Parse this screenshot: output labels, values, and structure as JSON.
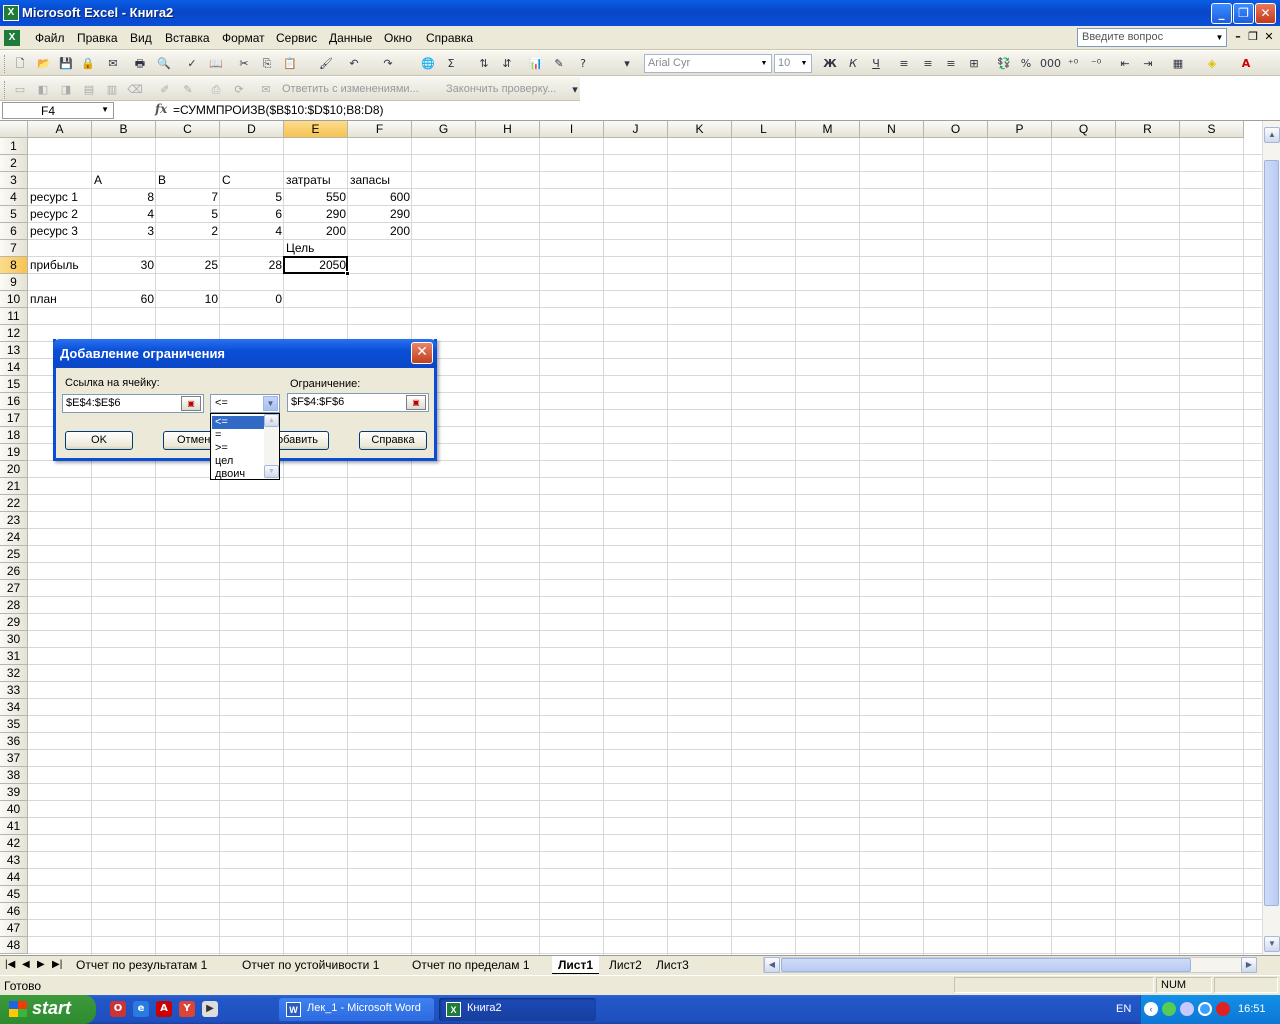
{
  "window": {
    "title": "Microsoft Excel - Книга2",
    "app_icon_letter": "X"
  },
  "menu": {
    "items": [
      "Файл",
      "Правка",
      "Вид",
      "Вставка",
      "Формат",
      "Сервис",
      "Данные",
      "Окно",
      "Справка"
    ],
    "ask_placeholder": "Введите вопрос"
  },
  "toolbar": {
    "font_name": "Arial Cyr",
    "font_size": "10",
    "reviewing_reply": "Ответить с изменениями...",
    "reviewing_end": "Закончить проверку..."
  },
  "formula_bar": {
    "name_box": "F4",
    "fx": "fx",
    "formula": "=СУММПРОИЗВ($B$10:$D$10;B8:D8)"
  },
  "columns": [
    "A",
    "B",
    "C",
    "D",
    "E",
    "F",
    "G",
    "H",
    "I",
    "J",
    "K",
    "L",
    "M",
    "N",
    "O",
    "P",
    "Q",
    "R",
    "S"
  ],
  "selected_column": "E",
  "selected_row": "8",
  "rows": [
    "1",
    "2",
    "3",
    "4",
    "5",
    "6",
    "7",
    "8",
    "9",
    "10",
    "11",
    "12",
    "13",
    "14",
    "15",
    "16",
    "17",
    "18",
    "19",
    "20",
    "21",
    "22",
    "23",
    "24",
    "25",
    "26",
    "27",
    "28",
    "29",
    "30",
    "31",
    "32",
    "33",
    "34",
    "35",
    "36",
    "37",
    "38",
    "39",
    "40",
    "41",
    "42",
    "43",
    "44",
    "45",
    "46",
    "47",
    "48"
  ],
  "cells": {
    "B3": "A",
    "C3": "B",
    "D3": "C",
    "E3": "затраты",
    "F3": "запасы",
    "A4": "ресурс 1",
    "B4": "8",
    "C4": "7",
    "D4": "5",
    "E4": "550",
    "F4": "600",
    "A5": "ресурс 2",
    "B5": "4",
    "C5": "5",
    "D5": "6",
    "E5": "290",
    "F5": "290",
    "A6": "ресурс 3",
    "B6": "3",
    "C6": "2",
    "D6": "4",
    "E6": "200",
    "F6": "200",
    "E7": "Цель",
    "A8": "прибыль",
    "B8": "30",
    "C8": "25",
    "D8": "28",
    "E8": "2050",
    "A10": "план",
    "B10": "60",
    "C10": "10",
    "D10": "0"
  },
  "sheet_tabs": [
    {
      "label": "Отчет по результатам 1",
      "active": false
    },
    {
      "label": "Отчет по устойчивости 1",
      "active": false
    },
    {
      "label": "Отчет по пределам 1",
      "active": false
    },
    {
      "label": "Лист1",
      "active": true
    },
    {
      "label": "Лист2",
      "active": false
    },
    {
      "label": "Лист3",
      "active": false
    }
  ],
  "status": {
    "text": "Готово",
    "num": "NUM"
  },
  "dialog": {
    "title": "Добавление ограничения",
    "cell_ref_label": "Ссылка на ячейку:",
    "cell_ref_value": "$E$4:$E$6",
    "operator_value": "<=",
    "constraint_label": "Ограничение:",
    "constraint_value": "$F$4:$F$6",
    "operator_options": [
      "<=",
      "=",
      ">=",
      "цел",
      "двоич"
    ],
    "ok": "OK",
    "cancel": "Отмена",
    "add": "Добавить",
    "help": "Справка"
  },
  "taskbar": {
    "start": "start",
    "tasks": [
      "Лек_1 - Microsoft Word",
      "Книга2"
    ],
    "lang": "EN",
    "clock": "16:51"
  },
  "colors": {
    "title_blue": "#0a4ed8",
    "selection_header": "#f7c350",
    "start_green": "#3c9a3c",
    "taskbar_blue": "#2358c8",
    "list_highlight": "#316ac5"
  }
}
